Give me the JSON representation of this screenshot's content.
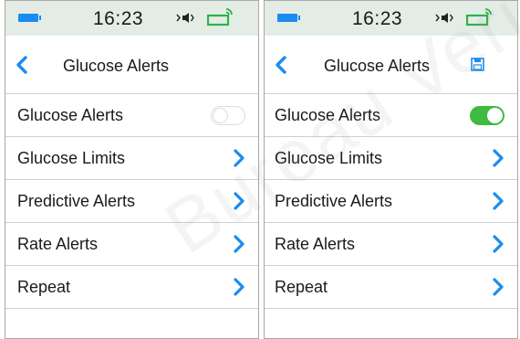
{
  "screens": [
    {
      "status": {
        "time": "16:23"
      },
      "header": {
        "title": "Glucose Alerts",
        "has_save": false
      },
      "rows": [
        {
          "label": "Glucose Alerts",
          "control": "toggle",
          "toggle_on": false
        },
        {
          "label": "Glucose Limits",
          "control": "chevron"
        },
        {
          "label": "Predictive Alerts",
          "control": "chevron"
        },
        {
          "label": "Rate Alerts",
          "control": "chevron"
        },
        {
          "label": "Repeat",
          "control": "chevron"
        }
      ]
    },
    {
      "status": {
        "time": "16:23"
      },
      "header": {
        "title": "Glucose Alerts",
        "has_save": true
      },
      "rows": [
        {
          "label": "Glucose Alerts",
          "control": "toggle",
          "toggle_on": true
        },
        {
          "label": "Glucose Limits",
          "control": "chevron"
        },
        {
          "label": "Predictive Alerts",
          "control": "chevron"
        },
        {
          "label": "Rate Alerts",
          "control": "chevron"
        },
        {
          "label": "Repeat",
          "control": "chevron"
        }
      ]
    }
  ],
  "icons": {
    "battery": "battery-icon",
    "speaker": "speaker-icon",
    "signal": "signal-icon",
    "back": "back-chevron-icon",
    "save": "save-icon",
    "chevron": "chevron-right-icon"
  },
  "colors": {
    "accent_blue": "#1a8cf0",
    "status_bar_bg": "#e3ede6",
    "signal_green": "#2db24a",
    "toggle_on": "#3fbb3f",
    "divider": "#cfcfcf"
  },
  "watermark": "Bureau Veritas"
}
